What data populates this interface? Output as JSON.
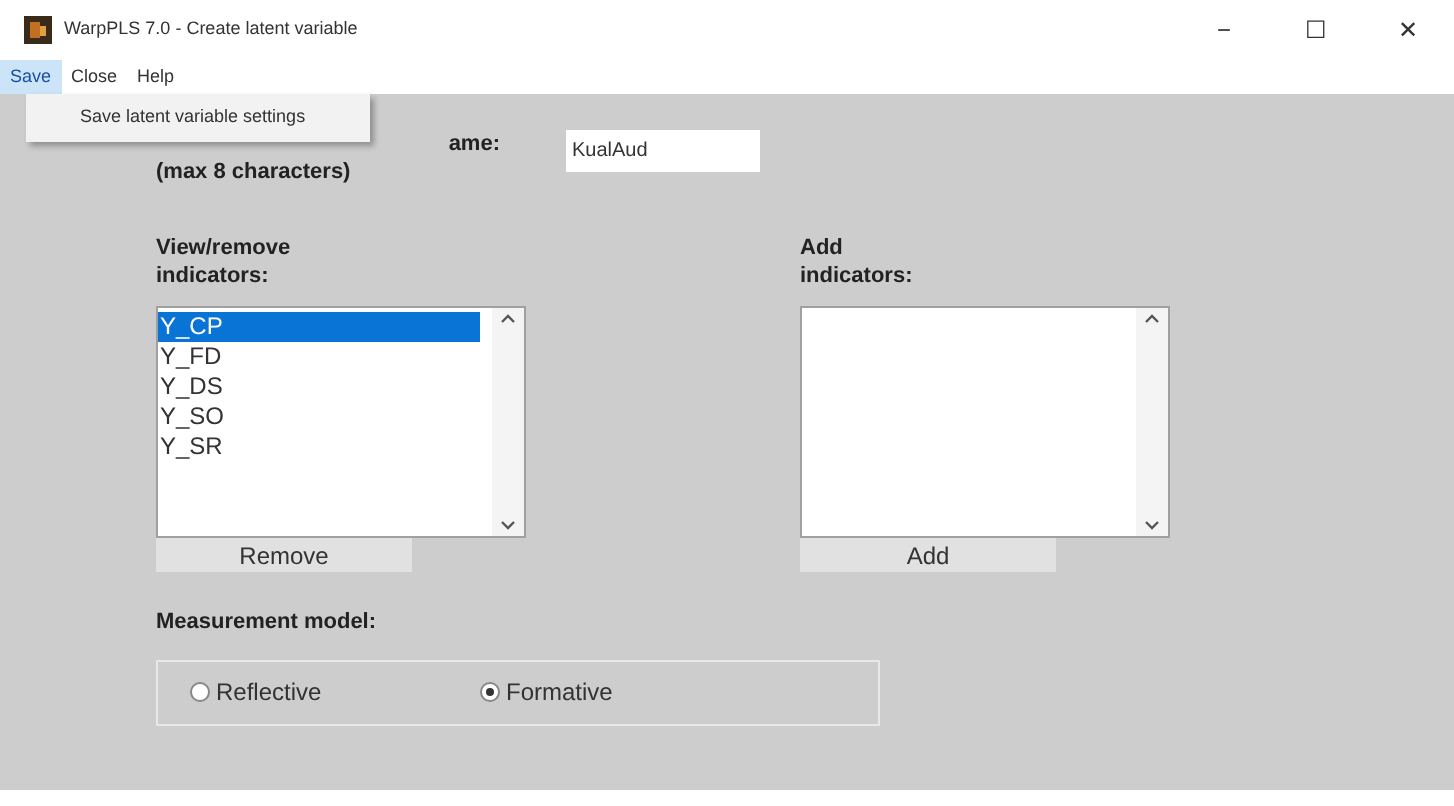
{
  "window": {
    "title": "WarpPLS 7.0 - Create latent variable",
    "controls": [
      "−",
      "☐",
      "✕"
    ]
  },
  "menu": [
    {
      "label": "Save",
      "selected": true
    },
    {
      "label": "Close",
      "selected": false
    },
    {
      "label": "Help",
      "selected": false
    }
  ],
  "dropdown": {
    "items": [
      "Save latent variable settings"
    ]
  },
  "name_field": {
    "label_visible": "ame:",
    "label_line2": "(max 8 characters)",
    "value": "KualAud"
  },
  "remove_panel": {
    "label": [
      "View/remove",
      "indicators:"
    ],
    "items": [
      {
        "label": "Y_CP",
        "selected": true
      },
      {
        "label": "Y_FD",
        "selected": false
      },
      {
        "label": "Y_DS",
        "selected": false
      },
      {
        "label": "Y_SO",
        "selected": false
      },
      {
        "label": "Y_SR",
        "selected": false
      }
    ],
    "button": "Remove"
  },
  "add_panel": {
    "label": [
      "Add",
      "indicators:"
    ],
    "button": "Add"
  },
  "measurement": {
    "label": "Measurement model:",
    "options": [
      {
        "label": "Reflective",
        "selected": false
      },
      {
        "label": "Formative",
        "selected": true
      }
    ]
  }
}
